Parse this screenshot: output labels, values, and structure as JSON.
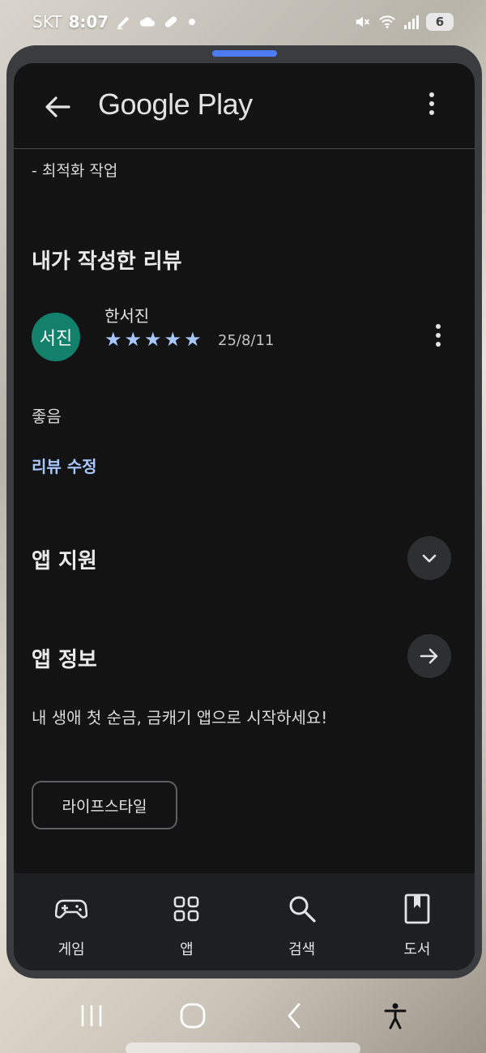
{
  "status_bar": {
    "carrier": "SKT",
    "time": "8:07",
    "battery_level": "6",
    "icons": [
      "edit-icon",
      "cloud-icon",
      "pill-icon",
      "dot-icon",
      "mute-icon",
      "wifi-icon",
      "signal-icon",
      "battery-icon"
    ]
  },
  "app_bar": {
    "title": "Google Play",
    "back_icon": "arrow-left-icon",
    "menu_icon": "more-vert-icon"
  },
  "whats_new": {
    "line": "- 최적화 작업"
  },
  "my_review": {
    "heading": "내가 작성한 리뷰",
    "avatar_text": "서진",
    "avatar_color": "#13806b",
    "reviewer_name": "한서진",
    "rating": 5,
    "rating_max": 5,
    "date": "25/8/11",
    "text": "좋음",
    "edit_label": "리뷰 수정"
  },
  "app_support": {
    "heading": "앱 지원",
    "icon": "chevron-down-icon"
  },
  "about_app": {
    "heading": "앱 정보",
    "icon": "arrow-right-icon",
    "description": "내 생애 첫 순금, 금캐기 앱으로 시작하세요!",
    "category": "라이프스타일"
  },
  "bottom_nav": {
    "items": [
      {
        "label": "게임",
        "icon": "gamepad-icon"
      },
      {
        "label": "앱",
        "icon": "apps-grid-icon"
      },
      {
        "label": "검색",
        "icon": "search-icon"
      },
      {
        "label": "도서",
        "icon": "book-icon"
      }
    ]
  },
  "colors": {
    "background": "#131314",
    "accent": "#a8c7fa",
    "drag_handle": "#4c7bf2",
    "nav_background": "#1e1f20"
  }
}
